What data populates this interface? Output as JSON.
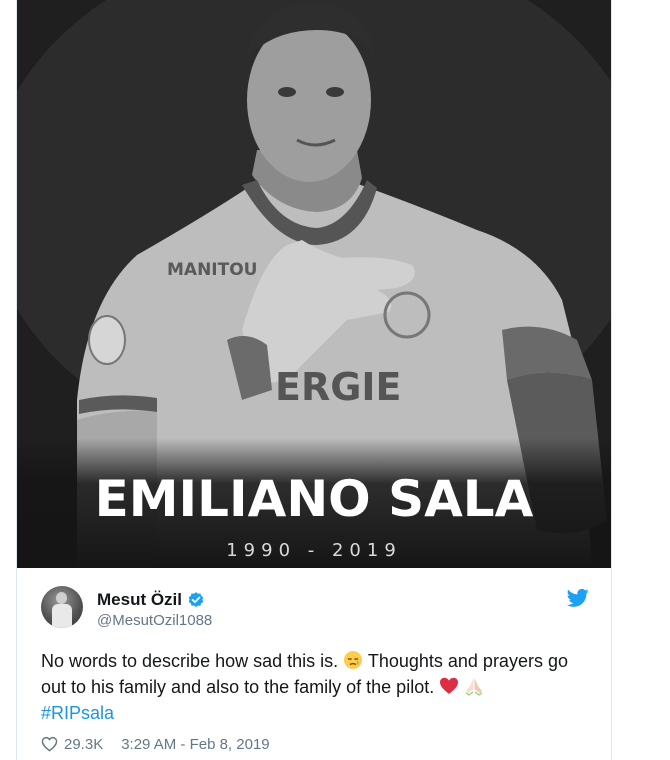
{
  "media": {
    "title": "EMILIANO SALA",
    "years": "1990 - 2019",
    "jersey_sponsor_chest": "ERGIE",
    "jersey_sponsor_sleeve": "MANITOU",
    "jersey_sponsor_top": "SYNERGIE"
  },
  "author": {
    "display_name": "Mesut Özil",
    "handle": "@MesutOzil1088",
    "verified": true
  },
  "tweet": {
    "text_part1": "No words to describe how sad this is.",
    "text_part2": "Thoughts and prayers go out to his family and also to the family of the pilot.",
    "hashtag": "#RIPsala",
    "emoji": [
      "sad-relieved-face",
      "red-heart",
      "folded-hands"
    ]
  },
  "footer": {
    "like_count": "29.3K",
    "timestamp": "3:29 AM - Feb 8, 2019"
  },
  "colors": {
    "link": "#1b95e0",
    "secondary_text": "#657786",
    "twitter_blue": "#1da1f2",
    "heart_red": "#e0245e"
  }
}
